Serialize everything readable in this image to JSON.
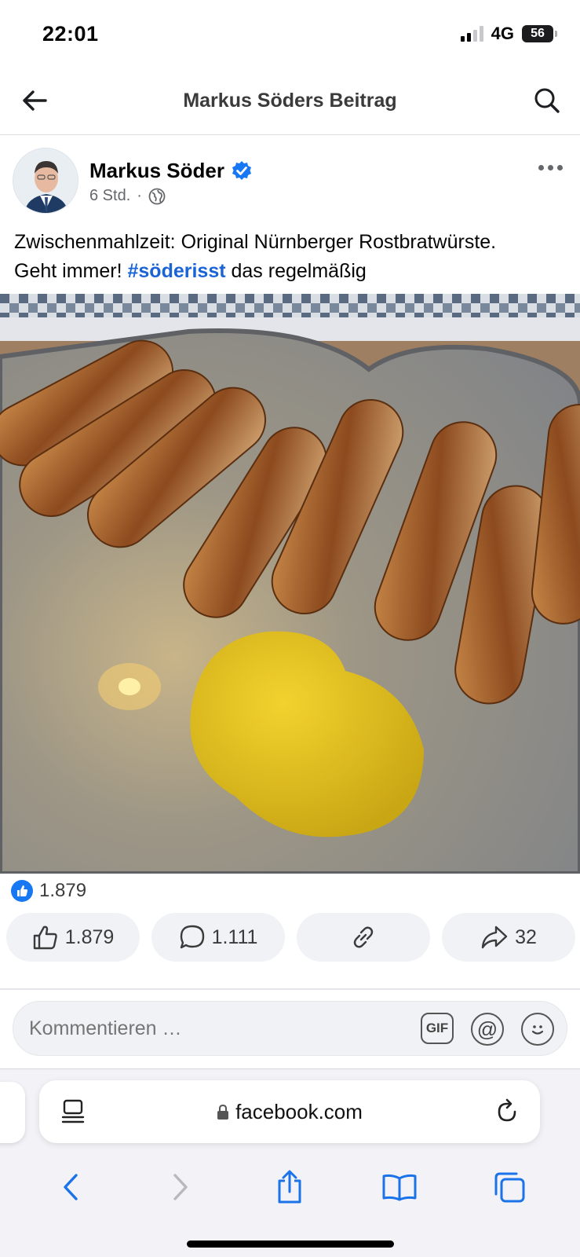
{
  "status_bar": {
    "time": "22:01",
    "network": "4G",
    "battery": "56"
  },
  "nav": {
    "title": "Markus Söders Beitrag"
  },
  "post": {
    "author": "Markus Söder",
    "time": "6 Std.",
    "separator": "·",
    "text_line1": "Zwischenmahlzeit: Original Nürnberger Rostbratwürste.",
    "text_line2_before": "Geht immer! ",
    "hashtag": "#söderisst",
    "text_line2_after": " das regelmäßig"
  },
  "reactions": {
    "count": "1.879"
  },
  "actions": {
    "like_count": "1.879",
    "comment_count": "1.111",
    "share_count": "32"
  },
  "comment": {
    "placeholder": "Kommentieren …",
    "gif_label": "GIF",
    "at_label": "@"
  },
  "browser": {
    "url": "facebook.com"
  },
  "colors": {
    "accent": "#1877f2",
    "hashtag": "#1a64d6",
    "verified": "#1877f2"
  }
}
